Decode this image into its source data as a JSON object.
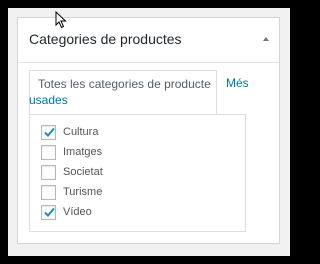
{
  "metabox": {
    "title": "Categories de productes",
    "tabs": {
      "active": "Totes les categories de producte",
      "other_line1": "Més",
      "other_line2": "usades"
    },
    "categories": [
      {
        "label": "Cultura",
        "checked": true
      },
      {
        "label": "Imatges",
        "checked": false
      },
      {
        "label": "Societat",
        "checked": false
      },
      {
        "label": "Turisme",
        "checked": false
      },
      {
        "label": "Vídeo",
        "checked": true
      }
    ]
  },
  "colors": {
    "checkmark": "#1e8cbe",
    "link": "#0073aa",
    "frame": "#000000"
  }
}
